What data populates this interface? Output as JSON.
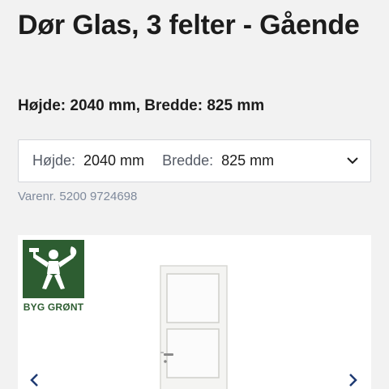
{
  "product": {
    "title": "Dør Glas, 3 felter - Gående",
    "subtitle": "Højde: 2040 mm, Bredde: 825 mm",
    "sku": "Varenr. 5200 9724698"
  },
  "variant": {
    "height_label": "Højde:",
    "height_value": "2040 mm",
    "width_label": "Bredde:",
    "width_value": "825 mm",
    "dropdown_icon": "chevron-down-icon"
  },
  "gallery": {
    "badge_text": "BYG GRØNT",
    "badge_color": "#2d5d31",
    "prev_icon": "chevron-left-icon",
    "next_icon": "chevron-right-icon",
    "accent_color": "#1f3b73"
  }
}
